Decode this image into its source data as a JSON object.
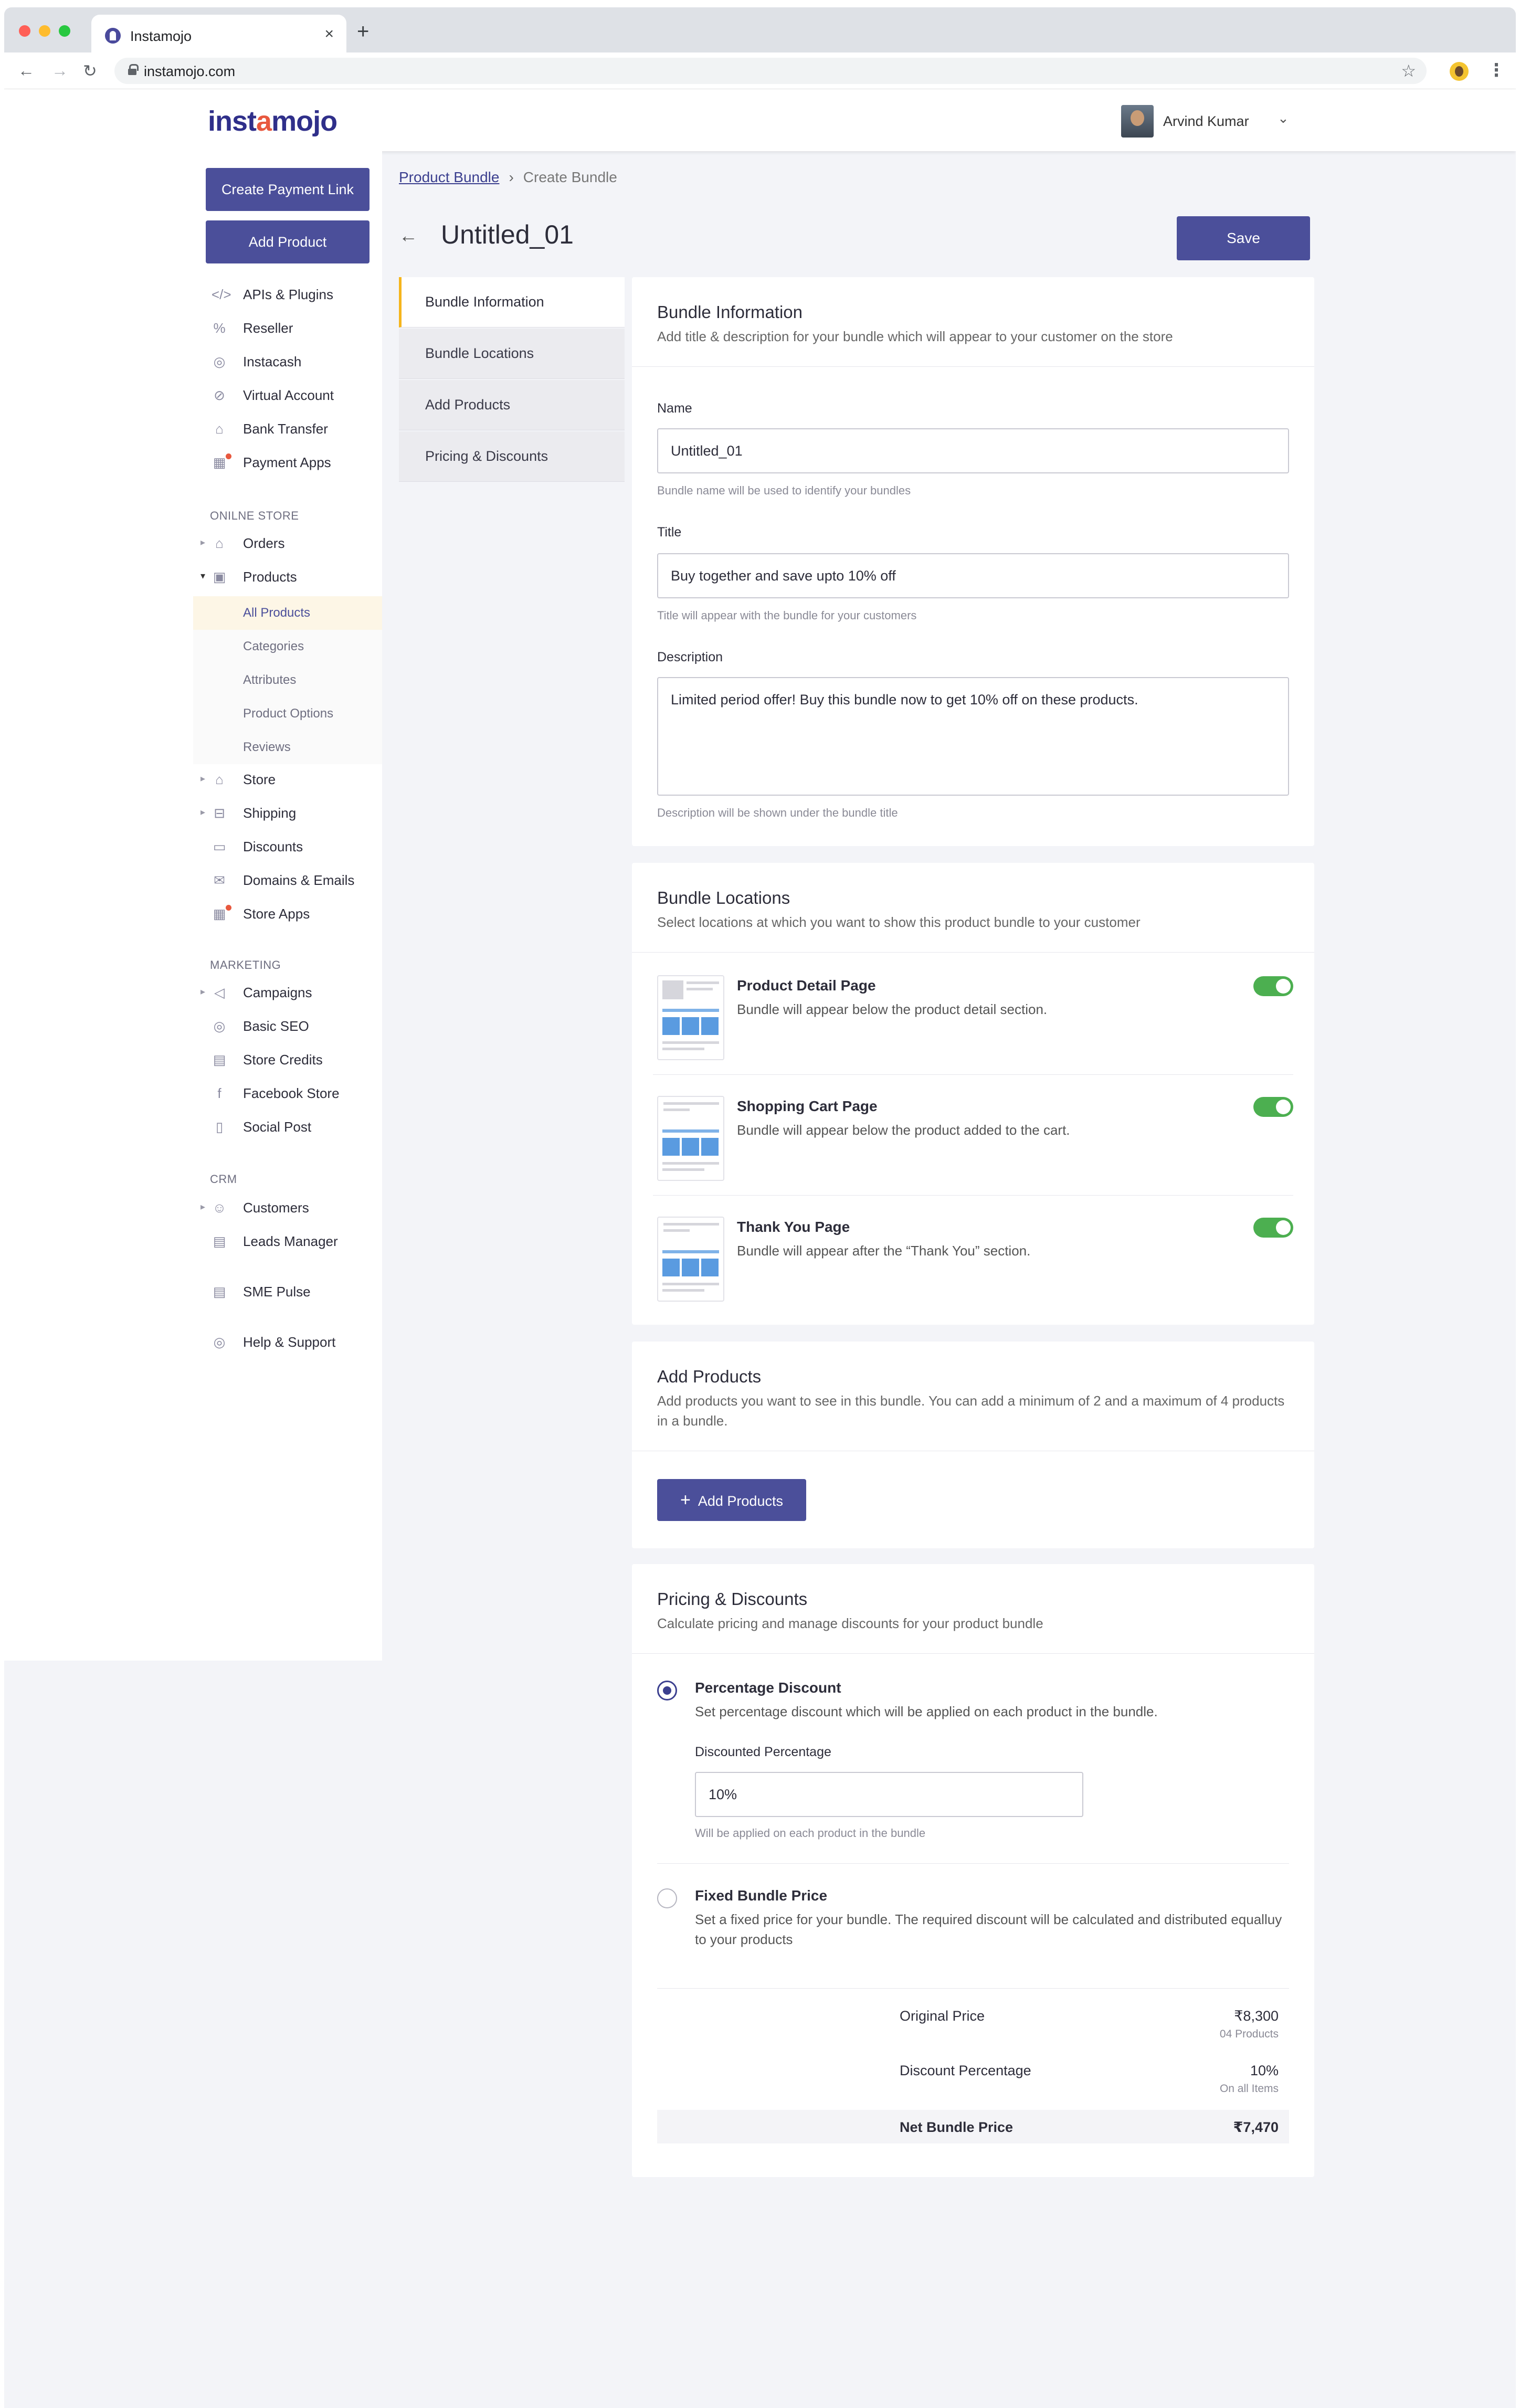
{
  "browser": {
    "tab_title": "Instamojo",
    "url": "instamojo.com",
    "close_glyph": "×",
    "new_tab_glyph": "+"
  },
  "header": {
    "logo_pre": "inst",
    "logo_accent": "a",
    "logo_post": "mojo",
    "user_name": "Arvind Kumar",
    "brand_color": "#2f2f8a",
    "accent_color": "#e8583e"
  },
  "sidebar": {
    "create_payment_link": "Create Payment Link",
    "add_product": "Add Product",
    "top_items": [
      {
        "label": "APIs & Plugins",
        "icon": "code-icon"
      },
      {
        "label": "Reseller",
        "icon": "percent-icon"
      },
      {
        "label": "Instacash",
        "icon": "cash-icon"
      },
      {
        "label": "Virtual Account",
        "icon": "link-icon"
      },
      {
        "label": "Bank Transfer",
        "icon": "bank-icon"
      },
      {
        "label": "Payment Apps",
        "icon": "apps-icon"
      }
    ],
    "section_online_store": "ONILNE STORE",
    "orders": "Orders",
    "products": "Products",
    "product_sub": [
      "All Products",
      "Categories",
      "Attributes",
      "Product Options",
      "Reviews"
    ],
    "store_items": [
      "Store",
      "Shipping",
      "Discounts",
      "Domains & Emails",
      "Store Apps"
    ],
    "section_marketing": "MARKETING",
    "marketing_items": [
      "Campaigns",
      "Basic SEO",
      "Store Credits",
      "Facebook Store",
      "Social Post"
    ],
    "section_crm": "CRM",
    "crm_items": [
      "Customers",
      "Leads Manager"
    ],
    "sme_pulse": "SME Pulse",
    "help": "Help & Support"
  },
  "breadcrumb": {
    "parent": "Product Bundle",
    "separator": "›",
    "current": "Create Bundle"
  },
  "page": {
    "title": "Untitled_01",
    "save": "Save",
    "back_glyph": "←"
  },
  "section_tabs": [
    "Bundle Information",
    "Bundle Locations",
    "Add Products",
    "Pricing & Discounts"
  ],
  "bundle_info": {
    "heading": "Bundle Information",
    "sub": "Add title & description for your bundle which will appear to your customer on the store",
    "name_label": "Name",
    "name_value": "Untitled_01",
    "name_hint": "Bundle name will be used to identify your bundles",
    "title_label": "Title",
    "title_value": "Buy together and save upto 10% off",
    "title_hint": "Title will appear with the bundle for your customers",
    "desc_label": "Description",
    "desc_value": "Limited period offer! Buy this bundle now to get 10% off on these products.",
    "desc_hint": "Description will be shown under the bundle title"
  },
  "bundle_locations": {
    "heading": "Bundle Locations",
    "sub": "Select locations at which you want to show this product bundle to your customer",
    "items": [
      {
        "title": "Product Detail Page",
        "desc": "Bundle will appear below the product detail section.",
        "enabled": true
      },
      {
        "title": "Shopping Cart Page",
        "desc": "Bundle will appear below the product added to the cart.",
        "enabled": true
      },
      {
        "title": "Thank You Page",
        "desc": "Bundle will appear after the “Thank You” section.",
        "enabled": true
      }
    ]
  },
  "add_products": {
    "heading": "Add Products",
    "sub": "Add products you want to see in this bundle. You can add a minimum of 2 and a maximum of 4 products in a bundle.",
    "button": "Add Products",
    "plus_glyph": "+"
  },
  "pricing": {
    "heading": "Pricing & Discounts",
    "sub": "Calculate pricing and manage discounts for your product bundle",
    "percentage_title": "Percentage Discount",
    "percentage_desc": "Set percentage discount which will be applied on each product in the bundle.",
    "discounted_label": "Discounted Percentage",
    "discounted_value": "10%",
    "discounted_hint": "Will be applied on each product in the bundle",
    "fixed_title": "Fixed Bundle Price",
    "fixed_desc": "Set a fixed price for your bundle. The required discount will be calculated and distributed equalluy to your products",
    "selected": "percentage",
    "original_label": "Original Price",
    "original_value": "₹8,300",
    "original_sub": "04 Products",
    "discount_label": "Discount Percentage",
    "discount_value": "10%",
    "discount_sub": "On all Items",
    "net_label": "Net Bundle Price",
    "net_value": "₹7,470"
  },
  "colors": {
    "primary": "#4b4f9a",
    "toggle_on": "#4caf50",
    "active_tab_marker": "#f5b51c"
  }
}
